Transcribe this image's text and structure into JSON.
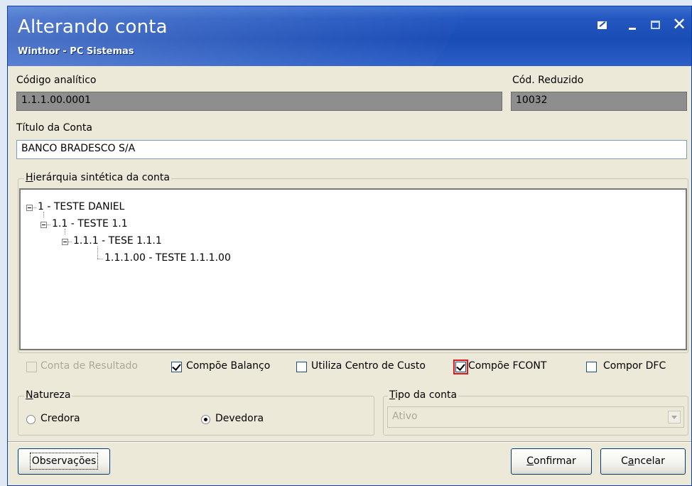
{
  "window": {
    "title": "Alterando conta",
    "subtitle": "Winthor - PC Sistemas"
  },
  "fields": {
    "codigo_label": "Código analítico",
    "codigo_value": "1.1.1.00.0001",
    "reduzido_label": "Cód. Reduzido",
    "reduzido_value": "10032",
    "titulo_label": "Título da Conta",
    "titulo_value": "BANCO BRADESCO S/A"
  },
  "hierarchy": {
    "label_first": "H",
    "label_rest": "ierárquia sintética da conta",
    "nodes": [
      "1 - TESTE DANIEL",
      "1.1 - TESTE 1.1",
      "1.1.1 - TESE 1.1.1",
      "1.1.1.00 - TESTE 1.1.1.00"
    ]
  },
  "checkboxes": [
    {
      "label": "Conta de Resultado",
      "checked": false,
      "disabled": true
    },
    {
      "label": "Compõe Balanço",
      "checked": true,
      "disabled": false
    },
    {
      "label": "Utiliza Centro de Custo",
      "checked": false,
      "disabled": false
    },
    {
      "label": "Compõe FCONT",
      "checked": true,
      "disabled": false,
      "highlighted": true
    },
    {
      "label": "Compor DFC",
      "checked": false,
      "disabled": false
    }
  ],
  "natureza": {
    "label_first": "N",
    "label_rest": "atureza",
    "options": [
      "Credora",
      "Devedora"
    ],
    "selected": "Devedora"
  },
  "tipo_conta": {
    "label_first": "T",
    "label_rest": "ipo da conta",
    "value": "Ativo"
  },
  "buttons": {
    "observacoes": "Observações",
    "confirmar_first": "C",
    "confirmar_rest": "onfirmar",
    "cancelar_pre": "C",
    "cancelar_u": "a",
    "cancelar_post": "ncelar"
  },
  "colors": {
    "titlebar": "#1a4cb6",
    "window_bg": "#ece9d8",
    "highlight": "#e0161c"
  }
}
